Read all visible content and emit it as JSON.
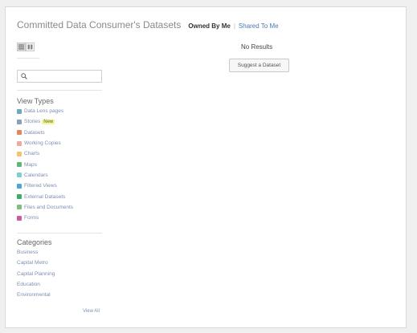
{
  "header": {
    "title": "Committed Data Consumer's Datasets",
    "filters": [
      {
        "label": "Owned By Me",
        "active": true
      },
      {
        "label": "Shared To Me",
        "active": false
      }
    ]
  },
  "search": {
    "placeholder": "",
    "value": ""
  },
  "view_types": {
    "title": "View Types",
    "items": [
      {
        "label": "Data Lens pages",
        "icon": "data-lens-icon",
        "color": "#6fa7c9"
      },
      {
        "label": "Stories",
        "badge": "New",
        "icon": "stories-icon",
        "color": "#8a9fb8"
      },
      {
        "label": "Datasets",
        "icon": "datasets-icon",
        "color": "#e8845a"
      },
      {
        "label": "Working Copies",
        "icon": "working-copies-icon",
        "color": "#f0a8a0"
      },
      {
        "label": "Charts",
        "icon": "charts-icon",
        "color": "#f5c46a"
      },
      {
        "label": "Maps",
        "icon": "maps-icon",
        "color": "#5cb87a"
      },
      {
        "label": "Calendars",
        "icon": "calendars-icon",
        "color": "#7ccfd4"
      },
      {
        "label": "Filtered Views",
        "icon": "filtered-views-icon",
        "color": "#4aa8d8"
      },
      {
        "label": "External Datasets",
        "icon": "external-datasets-icon",
        "color": "#3cae6a"
      },
      {
        "label": "Files and Documents",
        "icon": "files-documents-icon",
        "color": "#7cc07a"
      },
      {
        "label": "Forms",
        "icon": "forms-icon",
        "color": "#d05aa0"
      }
    ]
  },
  "categories": {
    "title": "Categories",
    "items": [
      "Business",
      "Capital Metro",
      "Capital Planning",
      "Education",
      "Environmental"
    ],
    "view_all": "View All"
  },
  "main": {
    "no_results": "No Results",
    "suggest_button": "Suggest a Dataset"
  }
}
